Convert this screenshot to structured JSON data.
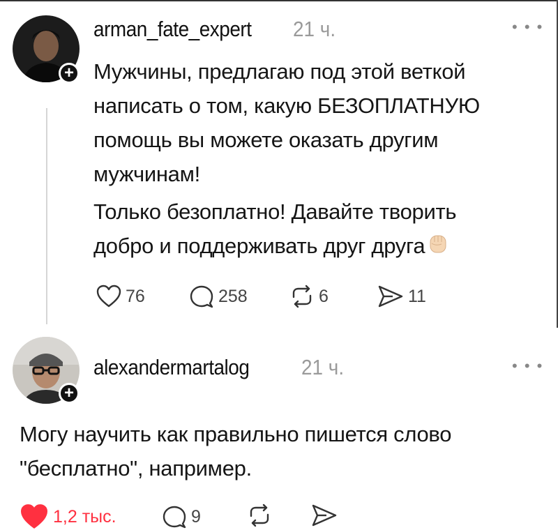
{
  "post": {
    "username": "arman_fate_expert",
    "time": "21 ч.",
    "text_lines": [
      "Мужчины, предлагаю под этой веткой",
      "написать о том, какую БЕЗОПЛАТНУЮ",
      "помощь вы можете оказать другим",
      "мужчинам!"
    ],
    "text2_lines": [
      "Только безоплатно! Давайте творить",
      "добро и поддерживать друг друга"
    ],
    "emoji": "✊🏻",
    "likes": "76",
    "comments": "258",
    "reposts": "6",
    "shares": "11"
  },
  "reply": {
    "username": "alexandermartalog",
    "time": "21 ч.",
    "text_lines": [
      "Могу научить как правильно пишется слово",
      "\"бесплатно\", например."
    ],
    "likes": "1,2 тыс.",
    "comments": "9"
  },
  "icons": {
    "like": "heart-icon",
    "comment": "comment-bubble-icon",
    "repost": "repost-icon",
    "share": "send-icon",
    "more": "more-dots-icon",
    "follow": "plus-icon"
  },
  "colors": {
    "like_active": "#ff3040",
    "muted": "#9a9a9a"
  }
}
